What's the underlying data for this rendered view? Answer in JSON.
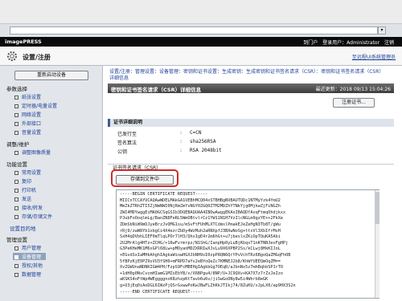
{
  "browser": {
    "go_button": "▾"
  },
  "topbar": {
    "brand": "imagePRESS",
    "links": [
      "到门户",
      "登录用户：Administrator",
      "注销"
    ]
  },
  "header": {
    "title": "设置/注册",
    "portal_link": "至远程UI系统管理员"
  },
  "sidebar": {
    "restart_button": "重新启动设备",
    "sections": [
      {
        "title": "参数选择",
        "items": [
          "纸张设置",
          "定时器/电量设置",
          "网络设置",
          "外部接口",
          "音量设置"
        ]
      },
      {
        "title": "调整/维护",
        "items": [
          "调整图像质量"
        ]
      },
      {
        "title": "功能设置",
        "items": [
          "常用设置",
          "复印",
          "打印机",
          "发送",
          "接收/转发",
          "存储/存储文件"
        ]
      },
      {
        "title": "设置目的地",
        "items": []
      },
      {
        "title": "管理设置",
        "items": [
          "用户管理",
          "设备管理",
          "授权/其他",
          "数据管理"
        ]
      }
    ],
    "active_item": "设备管理"
  },
  "main": {
    "breadcrumb": "设置/注册：管理设置：设备管理：密钥和证书设置：生成密钥：生成密钥和证书签名请求（CSR）：密钥和证书签名请求（CSR）详细信息",
    "panel_title": "密钥和证书签名请求（CSR）详细信息",
    "last_updated_label": "最近更新：",
    "last_updated_value": "2018 09/13 15:04:26",
    "register_button": "注册证书...",
    "info_title": "证书详细说明",
    "info_rows": [
      {
        "label": "已发行至",
        "value": "C=CN"
      },
      {
        "label": "签名算法",
        "value": "sha256RSA"
      },
      {
        "label": "公钥",
        "value": "RSA  2048bit"
      }
    ],
    "csr_title": "证书签名请求（CSR）",
    "save_button": "存储到文件中",
    "csr_text": "-----BEGIN CERTIFICATE REQUEST-----\nMIICnTCCAYUCAQAwWDELMAkGA1UEBhMCQ04xSTBHBgNVBAUTQDc1NTMyYzk4YmU2\nMmZkZTRhZTI5ZjNmNWI0NjRmZmYxNGY0ZGQ0ZTM2MDZhYTNkYjg0MjkwZjFiNGZh\nZWI4MDYwggEiMA0GCSqGSIb3DQEBAQUAA4IBDwAwggEKAoIBAQDfAvqFtmqOhdjkxx\nPJubFoOoqlmLg/BanZN8FeRL5WmOBtvlrCz1YW11N1H7VzIlcNGLm9gzYE++2FkXe\nZDmSbNiW9mDJyeBrzJvOMG1su/mSvFtFUhMLXTCdmslPmakEJeZeHgN3Tb8T/gWu\nrRj9/zwW8Yb1xbgCi4X4ezrZbDy4WzMuh2aRNXpfJ3BXwNoSg+ttxVl3XbIfrMvH\nSxH4qDVbhLIEF0mTlqLPOr7lH3/QhxIgE4r2m6hGt+u7jbeslxZKiOpTQuKA5Abi\n2U2MrAlg4HTz+ZCHG/+16wFvrmrpz/N1ShG/IanpHp0yLuBjKbqsT1nKTNBJexFgHPj\nG3PeKHeMK1M6xGPl68Lw+pMOyanMDZXRRIwXJvLu9X6XPBP2Ss/kCLwj8HkKIJoL\n+EGvdSxIaMHkAhghIAgkaWiowHGXJbNH9xI0zpP8QN6QrYPvVchTRz6BgoQaZMGqFhOB\n5fBPzKjE0PZ9sVU3fSH0+mFRPD7aYv2eBYoQeZc7KMNEJ2b8/KhWfUEEQmOqZM==\nXvZGWUnaNDNKIGW4PH/FzpS9FcMBEHgIAgkbGg7OEqR/aJbnNx5z7mhBqhbSPJrTO\n+1dH0p0NsCvcmHIamG1MZsEbYB/x/X6BPgu4/8NP/U+JC9QXv+KA7X7z7rZxJeIzo\naKSKS4oFtWp4WEggggnxK8zhzpKtTavb6u6v/jiSwGoONy8w5i4Whrb8eGK\ng+U3jEq0iAoDGL6IWzPjQSrGxwwPoKwJBwFLZhKkJTIkj74/8ZuKU/xJpLX0/ap9HX3S2n\n-----END CERTIFICATE REQUEST-----"
  },
  "colors": {
    "topbar_bg": "#0b0b0b",
    "panel_head_bg": "#4a4a4a",
    "active_nav_bg": "#8fa3bd",
    "highlight_border": "#d22a2a",
    "link": "#1b3f9a"
  }
}
